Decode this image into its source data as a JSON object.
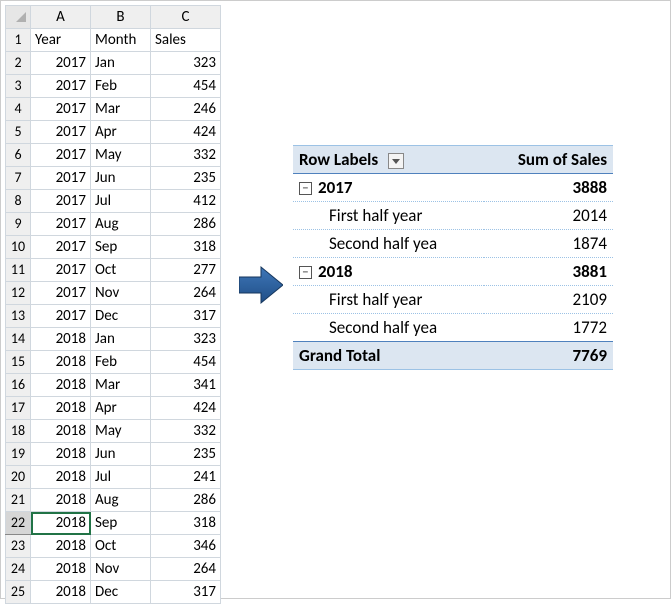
{
  "sheet": {
    "cols": [
      "A",
      "B",
      "C"
    ],
    "headers": {
      "A": "Year",
      "B": "Month",
      "C": "Sales"
    },
    "rows": [
      {
        "n": 2,
        "A": 2017,
        "B": "Jan",
        "C": 323
      },
      {
        "n": 3,
        "A": 2017,
        "B": "Feb",
        "C": 454
      },
      {
        "n": 4,
        "A": 2017,
        "B": "Mar",
        "C": 246
      },
      {
        "n": 5,
        "A": 2017,
        "B": "Apr",
        "C": 424
      },
      {
        "n": 6,
        "A": 2017,
        "B": "May",
        "C": 332
      },
      {
        "n": 7,
        "A": 2017,
        "B": "Jun",
        "C": 235
      },
      {
        "n": 8,
        "A": 2017,
        "B": "Jul",
        "C": 412
      },
      {
        "n": 9,
        "A": 2017,
        "B": "Aug",
        "C": 286
      },
      {
        "n": 10,
        "A": 2017,
        "B": "Sep",
        "C": 318
      },
      {
        "n": 11,
        "A": 2017,
        "B": "Oct",
        "C": 277
      },
      {
        "n": 12,
        "A": 2017,
        "B": "Nov",
        "C": 264
      },
      {
        "n": 13,
        "A": 2017,
        "B": "Dec",
        "C": 317
      },
      {
        "n": 14,
        "A": 2018,
        "B": "Jan",
        "C": 323
      },
      {
        "n": 15,
        "A": 2018,
        "B": "Feb",
        "C": 454
      },
      {
        "n": 16,
        "A": 2018,
        "B": "Mar",
        "C": 341
      },
      {
        "n": 17,
        "A": 2018,
        "B": "Apr",
        "C": 424
      },
      {
        "n": 18,
        "A": 2018,
        "B": "May",
        "C": 332
      },
      {
        "n": 19,
        "A": 2018,
        "B": "Jun",
        "C": 235
      },
      {
        "n": 20,
        "A": 2018,
        "B": "Jul",
        "C": 241
      },
      {
        "n": 21,
        "A": 2018,
        "B": "Aug",
        "C": 286
      },
      {
        "n": 22,
        "A": 2018,
        "B": "Sep",
        "C": 318
      },
      {
        "n": 23,
        "A": 2018,
        "B": "Oct",
        "C": 346
      },
      {
        "n": 24,
        "A": 2018,
        "B": "Nov",
        "C": 264
      },
      {
        "n": 25,
        "A": 2018,
        "B": "Dec",
        "C": 317
      }
    ],
    "selected_row": 22
  },
  "pivot": {
    "row_labels": "Row Labels",
    "sum_label": "Sum of Sales",
    "grand_label": "Grand Total",
    "grand_value": 7769,
    "collapse_glyph": "−",
    "groups": [
      {
        "year": "2017",
        "total": 3888,
        "half1_label": "First half year",
        "half1": 2014,
        "half2_label": "Second half yea",
        "half2": 1874
      },
      {
        "year": "2018",
        "total": 3881,
        "half1_label": "First half year",
        "half1": 2109,
        "half2_label": "Second half yea",
        "half2": 1772
      }
    ]
  }
}
